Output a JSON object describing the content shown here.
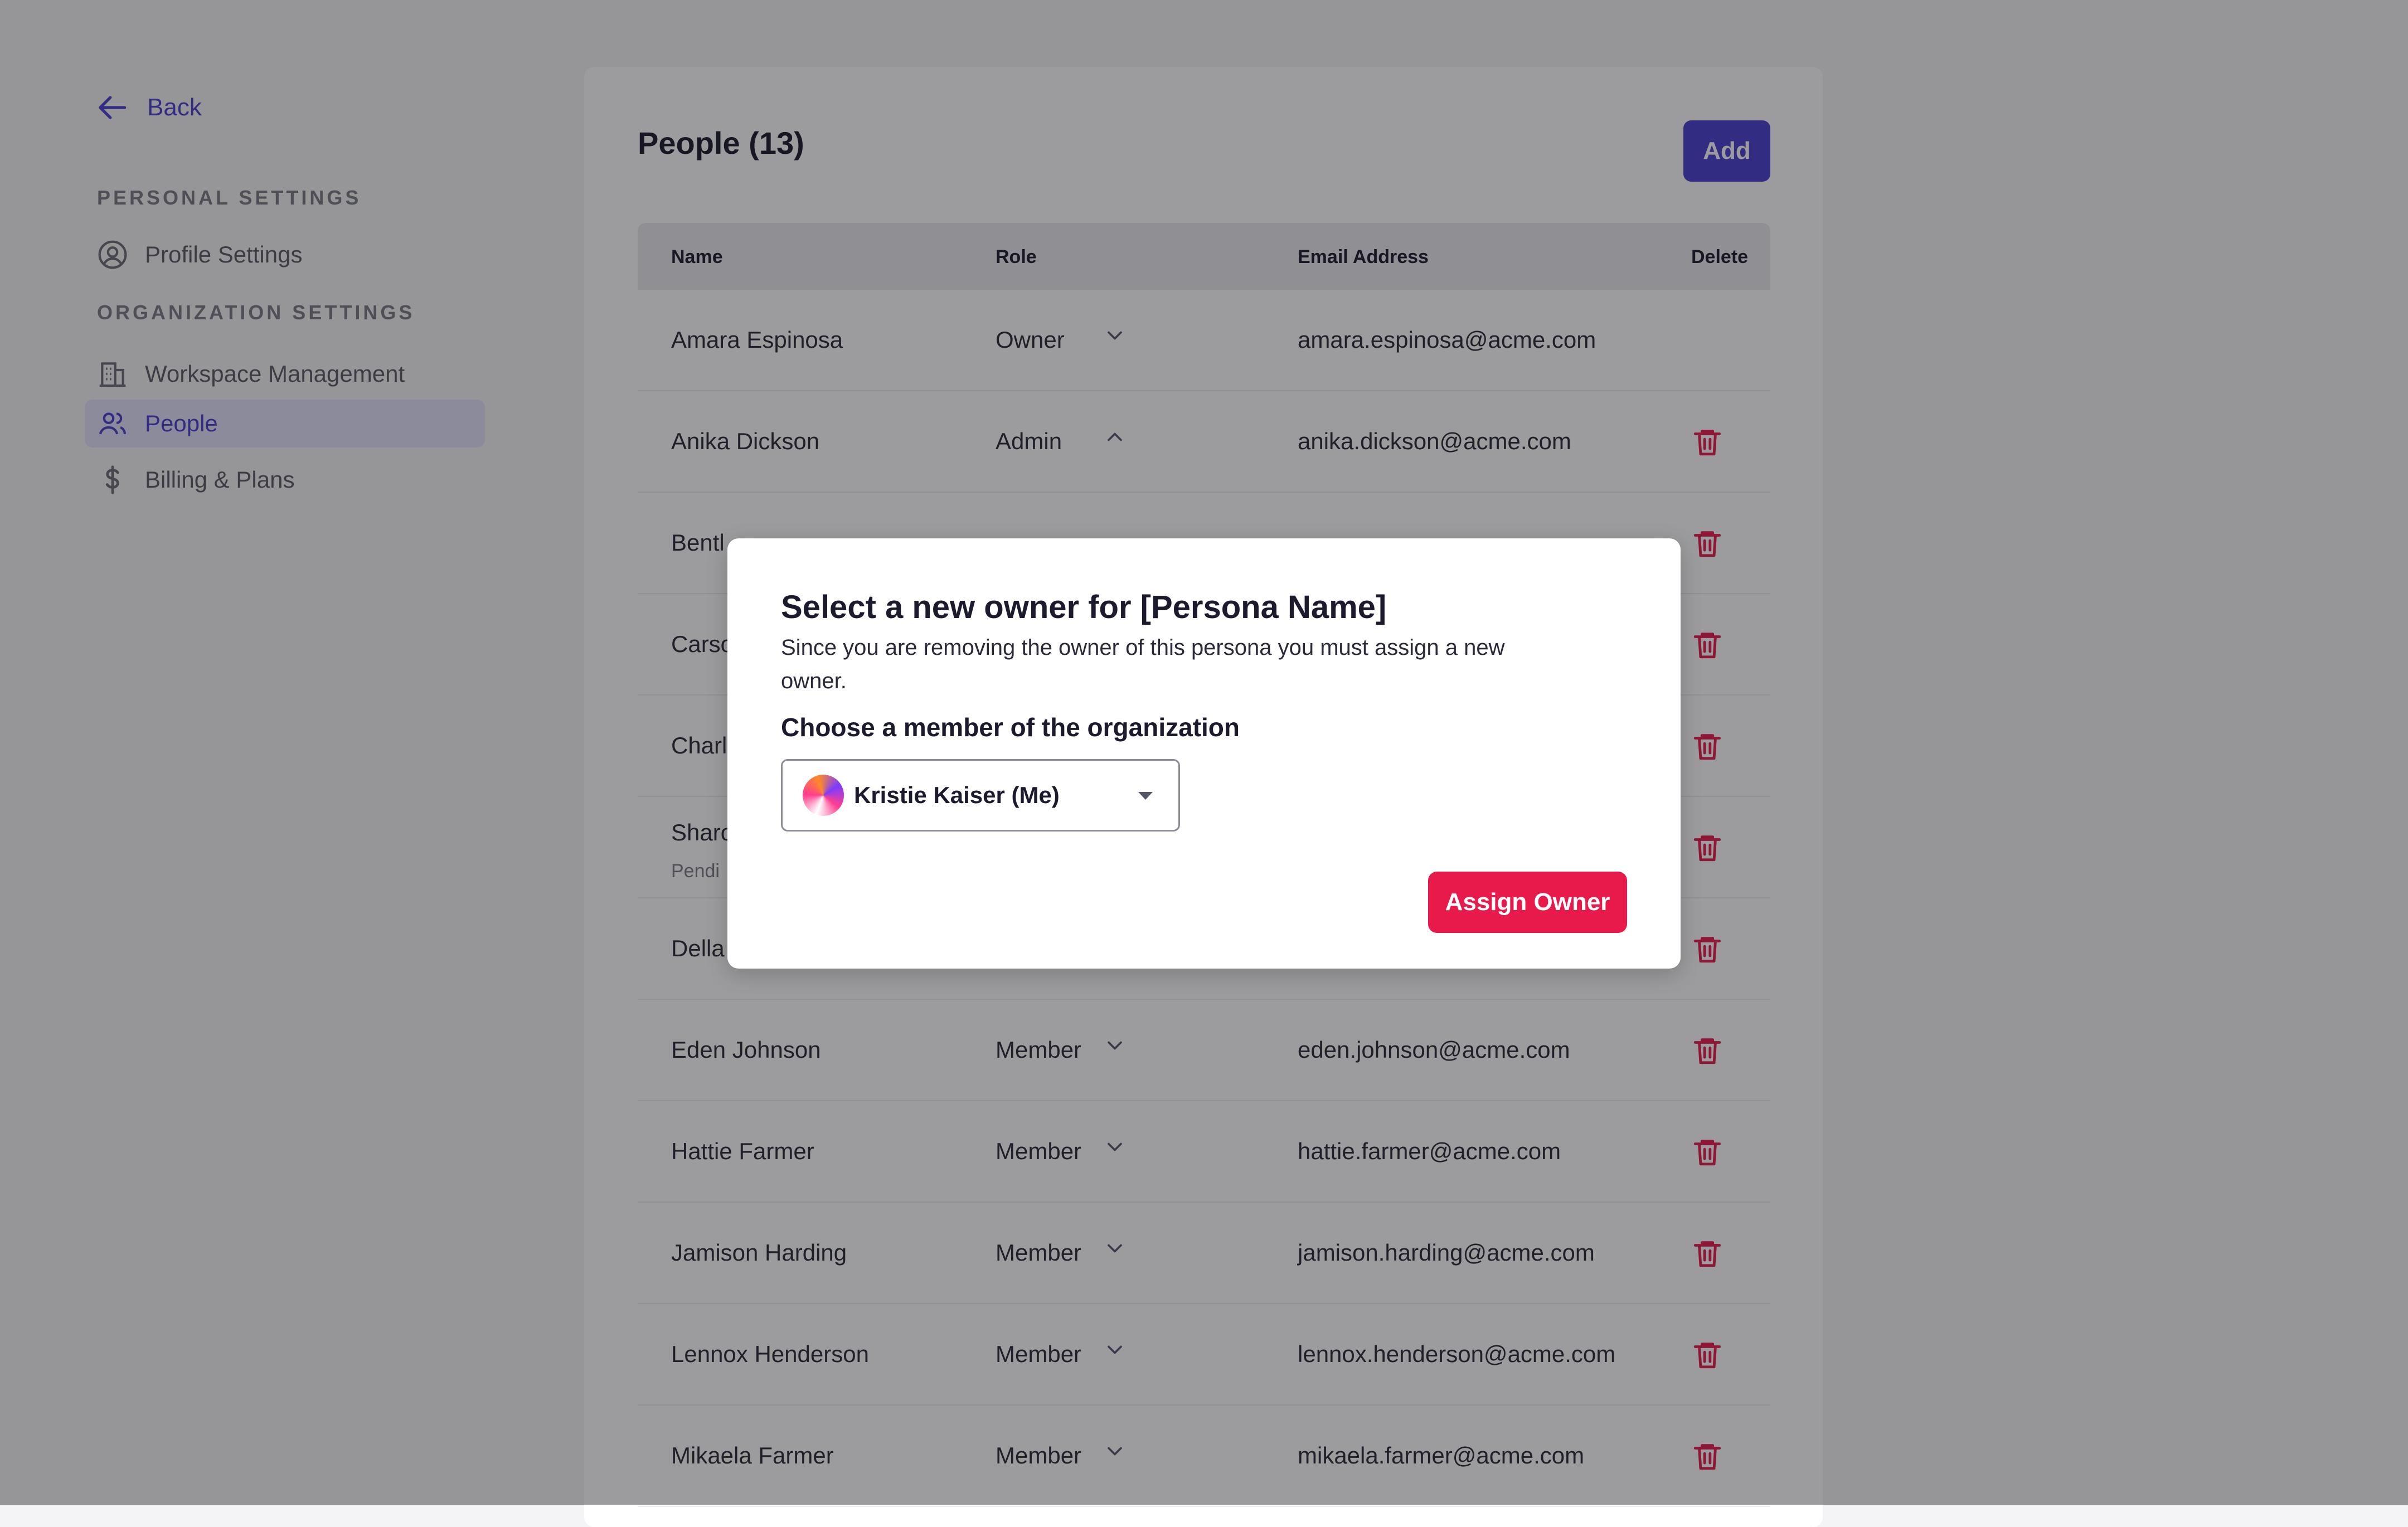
{
  "sidebar": {
    "back_label": "Back",
    "personal_title": "PERSONAL SETTINGS",
    "org_title": "ORGANIZATION SETTINGS",
    "items": [
      {
        "label": "Profile Settings",
        "icon": "user-circle-icon"
      },
      {
        "label": "Workspace Management",
        "icon": "building-icon"
      },
      {
        "label": "People",
        "icon": "users-icon",
        "active": true
      },
      {
        "label": "Billing & Plans",
        "icon": "dollar-icon"
      }
    ]
  },
  "main": {
    "title": "People (13)",
    "add_label": "Add",
    "columns": [
      "Name",
      "Role",
      "Email Address",
      "Delete"
    ],
    "rows": [
      {
        "name": "Amara Espinosa",
        "role": "Owner",
        "email": "amara.espinosa@acme.com",
        "chevron": "down",
        "deletable": false
      },
      {
        "name": "Anika Dickson",
        "role": "Admin",
        "email": "anika.dickson@acme.com",
        "chevron": "up",
        "deletable": true
      },
      {
        "name": "Bentl",
        "role": "",
        "email": "",
        "chevron": "",
        "deletable": true
      },
      {
        "name": "Carso",
        "role": "",
        "email": "",
        "chevron": "",
        "deletable": true
      },
      {
        "name": "Charl",
        "role": "",
        "email": "",
        "chevron": "",
        "deletable": true
      },
      {
        "name": "Sharo",
        "sub": "Pendi",
        "role": "",
        "email": "",
        "chevron": "",
        "deletable": true
      },
      {
        "name": "Della",
        "role": "",
        "email": "",
        "chevron": "",
        "deletable": true
      },
      {
        "name": "Eden Johnson",
        "role": "Member",
        "email": "eden.johnson@acme.com",
        "chevron": "down",
        "deletable": true
      },
      {
        "name": "Hattie Farmer",
        "role": "Member",
        "email": "hattie.farmer@acme.com",
        "chevron": "down",
        "deletable": true
      },
      {
        "name": "Jamison Harding",
        "role": "Member",
        "email": "jamison.harding@acme.com",
        "chevron": "down",
        "deletable": true
      },
      {
        "name": "Lennox Henderson",
        "role": "Member",
        "email": "lennox.henderson@acme.com",
        "chevron": "down",
        "deletable": true
      },
      {
        "name": "Mikaela Farmer",
        "role": "Member",
        "email": "mikaela.farmer@acme.com",
        "chevron": "down",
        "deletable": true
      }
    ]
  },
  "modal": {
    "title": "Select a new owner for [Persona Name]",
    "description": "Since you are removing the owner of this persona you must assign a new owner.",
    "label": "Choose a member of the organization",
    "selected_member": "Kristie Kaiser (Me)",
    "assign_label": "Assign Owner"
  },
  "colors": {
    "accent": "#4b3fd0",
    "danger": "#e8194b",
    "overlay": "rgba(20,20,24,0.42)"
  }
}
